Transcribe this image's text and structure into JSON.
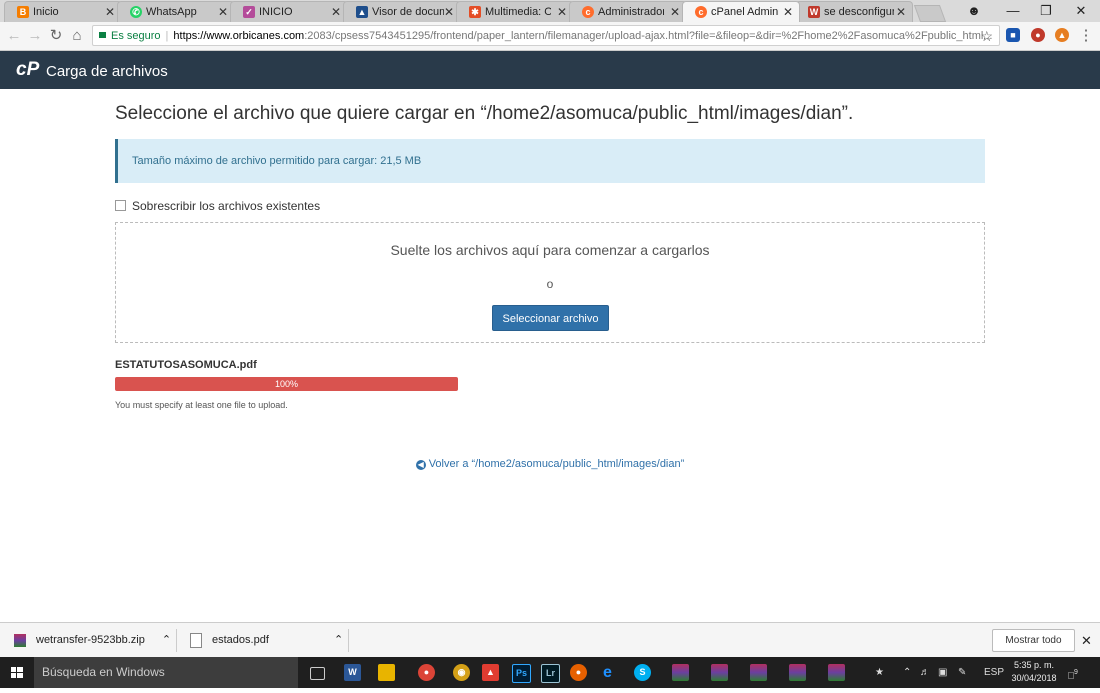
{
  "browser": {
    "tabs": [
      {
        "label": "Inicio",
        "icon": "blogger-icon",
        "color": "#f57d00"
      },
      {
        "label": "WhatsApp",
        "icon": "whatsapp-icon",
        "color": "#25d366"
      },
      {
        "label": "INICIO",
        "icon": "site-icon",
        "color": "#b44c9a"
      },
      {
        "label": "Visor de documentos",
        "icon": "docs-viewer-icon",
        "color": "#1e4e8c"
      },
      {
        "label": "Multimedia: Opciones",
        "icon": "joomla-icon",
        "color": "#e44d26"
      },
      {
        "label": "Administrador de archivos",
        "icon": "cpanel-icon",
        "color": "#ff6c2c"
      },
      {
        "label": "cPanel Administrador",
        "icon": "cpanel-icon",
        "color": "#ff6c2c"
      },
      {
        "label": "se desconfiguró",
        "icon": "web-icon",
        "color": "#c0392b"
      }
    ],
    "security_label": "Es seguro",
    "url_scheme_host": "https://www.orbicanes.com",
    "url_rest": ":2083/cpsess7543451295/frontend/paper_lantern/filemanager/upload-ajax.html?file=&fileop=&dir=%2Fhome2%2Fasomuca%2Fpublic_html..."
  },
  "header": {
    "logo": "cP",
    "title": "Carga de archivos"
  },
  "main": {
    "heading": "Seleccione el archivo que quiere cargar en “/home2/asomuca/public_html/images/dian”.",
    "max_size_notice": "Tamaño máximo de archivo permitido para cargar: 21,5 MB",
    "overwrite_label": "Sobrescribir los archivos existentes",
    "dropzone_text": "Suelte los archivos aquí para comenzar a cargarlos",
    "dropzone_or": "o",
    "select_button": "Seleccionar archivo",
    "upload": {
      "filename": "ESTATUTOSASOMUCA.pdf",
      "progress_percent": 100,
      "progress_label": "100%",
      "message": "You must specify at least one file to upload."
    },
    "back_link": "Volver a “/home2/asomuca/public_html/images/dian”"
  },
  "downloads": {
    "items": [
      {
        "name": "wetransfer-9523bb.zip",
        "icon": "zip-file-icon"
      },
      {
        "name": "estados.pdf",
        "icon": "pdf-file-icon"
      }
    ],
    "show_all": "Mostrar todo"
  },
  "taskbar": {
    "search_placeholder": "Búsqueda en Windows",
    "language": "ESP",
    "time": "5:35 p. m.",
    "date": "30/04/2018",
    "notification_count": "9"
  },
  "colors": {
    "header_bg": "#293a4a",
    "primary": "#3071a9",
    "danger": "#d9534f",
    "info_bg": "#d9edf7"
  }
}
